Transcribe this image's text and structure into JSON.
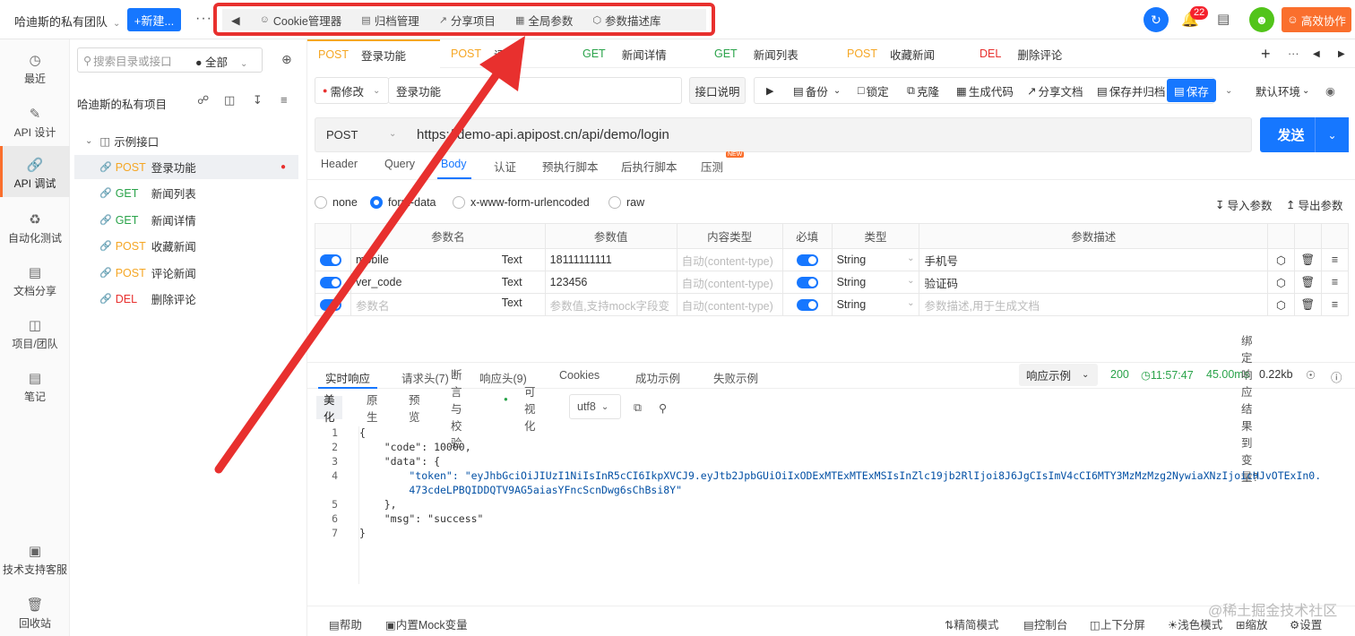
{
  "topbar": {
    "team": "哈迪斯的私有团队",
    "new_button": "+新建...",
    "more": "···",
    "tools": [
      {
        "label": "◀",
        "icon": ""
      },
      {
        "label": "Cookie管理器",
        "icon": "cookie-icon"
      },
      {
        "label": "归档管理",
        "icon": "archive-icon"
      },
      {
        "label": "分享项目",
        "icon": "share-icon"
      },
      {
        "label": "全局参数",
        "icon": "params-icon"
      },
      {
        "label": "参数描述库",
        "icon": "cube-icon"
      }
    ],
    "notification_count": "22",
    "collab_button": "高效协作",
    "accent_color": "#1677ff",
    "highlight_color": "#e8302e"
  },
  "rail": {
    "items": [
      {
        "label": "最近",
        "icon": "clock-icon"
      },
      {
        "label": "API 设计",
        "icon": "edit-icon"
      },
      {
        "label": "API 调试",
        "icon": "link-icon"
      },
      {
        "label": "自动化测试",
        "icon": "flow-icon"
      },
      {
        "label": "文档分享",
        "icon": "doc-icon"
      },
      {
        "label": "项目/团队",
        "icon": "folder-icon"
      },
      {
        "label": "笔记",
        "icon": "note-icon"
      },
      {
        "label": "技术支持客服",
        "icon": "support-icon"
      },
      {
        "label": "回收站",
        "icon": "trash-icon"
      }
    ]
  },
  "tree": {
    "search_placeholder": "搜索目录或接口",
    "scope": "● 全部",
    "project": "哈迪斯的私有项目",
    "folder": "示例接口",
    "items": [
      {
        "method": "POST",
        "name": "登录功能"
      },
      {
        "method": "GET",
        "name": "新闻列表"
      },
      {
        "method": "GET",
        "name": "新闻详情"
      },
      {
        "method": "POST",
        "name": "收藏新闻"
      },
      {
        "method": "POST",
        "name": "评论新闻"
      },
      {
        "method": "DEL",
        "name": "删除评论"
      }
    ]
  },
  "tabs": [
    {
      "method": "POST",
      "name": "登录功能"
    },
    {
      "method": "POST",
      "name": "评"
    },
    {
      "method": "GET",
      "name": "新闻详情"
    },
    {
      "method": "GET",
      "name": "新闻列表"
    },
    {
      "method": "POST",
      "name": "收藏新闻"
    },
    {
      "method": "DEL",
      "name": "删除评论"
    }
  ],
  "request": {
    "status": "需修改",
    "name": "登录功能",
    "desc_button": "接口说明",
    "actions": [
      "▶",
      "备份",
      "锁定",
      "克隆",
      "生成代码",
      "分享文档",
      "保存并归档",
      "保存"
    ],
    "env": "默认环境",
    "method": "POST",
    "url": "https://demo-api.apipost.cn/api/demo/login",
    "send": "发送"
  },
  "subtabs": [
    "Header",
    "Query",
    "Body",
    "认证",
    "预执行脚本",
    "后执行脚本",
    "压测"
  ],
  "new_tag": "NEW",
  "body_types": [
    "none",
    "form-data",
    "x-www-form-urlencoded",
    "raw"
  ],
  "import_params": "导入参数",
  "export_params": "导出参数",
  "params": {
    "headers": [
      "参数名",
      "参数值",
      "内容类型",
      "必填",
      "类型",
      "参数描述"
    ],
    "rows": [
      {
        "name": "mobile",
        "ftype": "Text",
        "value": "18111111111",
        "content_type": "自动(content-type)",
        "type": "String",
        "desc": "手机号"
      },
      {
        "name": "ver_code",
        "ftype": "Text",
        "value": "123456",
        "content_type": "自动(content-type)",
        "type": "String",
        "desc": "验证码"
      },
      {
        "name": "参数名",
        "ftype": "Text",
        "value": "参数值,支持mock字段变",
        "content_type": "自动(content-type)",
        "type": "String",
        "desc": "参数描述,用于生成文档"
      }
    ]
  },
  "response": {
    "tabs": [
      "实时响应",
      "请求头(7)",
      "响应头(9)",
      "Cookies",
      "成功示例",
      "失败示例"
    ],
    "example_select": "响应示例",
    "status": "200",
    "time": "11:57:47",
    "duration": "45.00ms",
    "size": "0.22kb",
    "views": [
      "美化",
      "原生",
      "预览",
      "断言与校验",
      "可视化"
    ],
    "encoding": "utf8",
    "bind_label": "绑定响应结果到变量?",
    "code_lines": [
      "{",
      "    \"code\": 10000,",
      "    \"data\": {",
      "        \"token\": \"eyJhbGciOiJIUzI1NiIsInR5cCI6IkpXVCJ9.eyJtb2JpbGUiOiIxODExMTExMTExMSIsInZlc19jb2RlIjoi8J6JgCIsImV4cCI6MTY3MzMzMzg2NywiaXNzIjoicHJvOTExIn0.",
      "        473cdeLPBQIDDQTV9AG5aiasYFncScnDwg6sChBsi8Y\"",
      "    },",
      "    \"msg\": \"success\"",
      "}"
    ],
    "line_numbers": [
      "1",
      "2",
      "3",
      "4",
      "",
      "5",
      "6",
      "7"
    ]
  },
  "bottom": {
    "items_left": [
      "帮助",
      "内置Mock变量"
    ],
    "items_right": [
      "精简模式",
      "控制台",
      "上下分屏",
      "浅色模式",
      "缩放",
      "设置"
    ]
  },
  "watermark": "@稀土掘金技术社区"
}
